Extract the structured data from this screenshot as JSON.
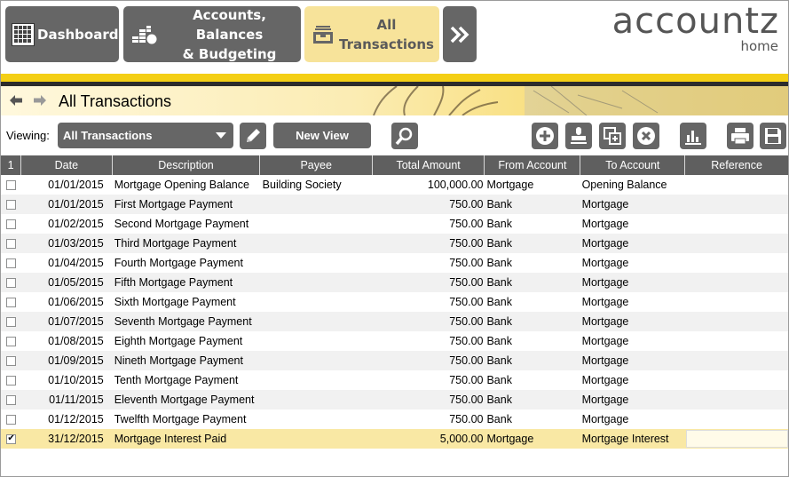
{
  "nav": {
    "dashboard": "Dashboard",
    "accounts_line1": "Accounts, Balances",
    "accounts_line2": "& Budgeting",
    "all_line1": "All",
    "all_line2": "Transactions",
    "more_icon": "double-chevron-right-icon"
  },
  "logo": {
    "brand": "accountz",
    "sub": "home"
  },
  "page": {
    "title": "All Transactions"
  },
  "toolbar": {
    "viewing_label": "Viewing:",
    "view_selected": "All Transactions",
    "new_view_label": "New View"
  },
  "table": {
    "columns": [
      "1",
      "Date",
      "Description",
      "Payee",
      "Total Amount",
      "From Account",
      "To Account",
      "Reference"
    ],
    "rows": [
      {
        "checked": "",
        "date": "01/01/2015",
        "description": "Mortgage Opening Balance",
        "payee": "Building Society",
        "amount": "100,000.00",
        "from": "Mortgage",
        "to": "Opening Balance",
        "reference": ""
      },
      {
        "checked": "",
        "date": "01/01/2015",
        "description": "First Mortgage Payment",
        "payee": "",
        "amount": "750.00",
        "from": "Bank",
        "to": "Mortgage",
        "reference": ""
      },
      {
        "checked": "",
        "date": "01/02/2015",
        "description": "Second Mortgage Payment",
        "payee": "",
        "amount": "750.00",
        "from": "Bank",
        "to": "Mortgage",
        "reference": ""
      },
      {
        "checked": "",
        "date": "01/03/2015",
        "description": "Third Mortgage Payment",
        "payee": "",
        "amount": "750.00",
        "from": "Bank",
        "to": "Mortgage",
        "reference": ""
      },
      {
        "checked": "",
        "date": "01/04/2015",
        "description": "Fourth Mortgage Payment",
        "payee": "",
        "amount": "750.00",
        "from": "Bank",
        "to": "Mortgage",
        "reference": ""
      },
      {
        "checked": "",
        "date": "01/05/2015",
        "description": "Fifth Mortgage Payment",
        "payee": "",
        "amount": "750.00",
        "from": "Bank",
        "to": "Mortgage",
        "reference": ""
      },
      {
        "checked": "",
        "date": "01/06/2015",
        "description": "Sixth Mortgage Payment",
        "payee": "",
        "amount": "750.00",
        "from": "Bank",
        "to": "Mortgage",
        "reference": ""
      },
      {
        "checked": "",
        "date": "01/07/2015",
        "description": "Seventh Mortgage Payment",
        "payee": "",
        "amount": "750.00",
        "from": "Bank",
        "to": "Mortgage",
        "reference": ""
      },
      {
        "checked": "",
        "date": "01/08/2015",
        "description": "Eighth Mortgage Payment",
        "payee": "",
        "amount": "750.00",
        "from": "Bank",
        "to": "Mortgage",
        "reference": ""
      },
      {
        "checked": "",
        "date": "01/09/2015",
        "description": "Nineth Mortgage Payment",
        "payee": "",
        "amount": "750.00",
        "from": "Bank",
        "to": "Mortgage",
        "reference": ""
      },
      {
        "checked": "",
        "date": "01/10/2015",
        "description": "Tenth Mortgage Payment",
        "payee": "",
        "amount": "750.00",
        "from": "Bank",
        "to": "Mortgage",
        "reference": ""
      },
      {
        "checked": "",
        "date": "01/11/2015",
        "description": "Eleventh Mortgage Payment",
        "payee": "",
        "amount": "750.00",
        "from": "Bank",
        "to": "Mortgage",
        "reference": ""
      },
      {
        "checked": "",
        "date": "01/12/2015",
        "description": "Twelfth Mortgage Payment",
        "payee": "",
        "amount": "750.00",
        "from": "Bank",
        "to": "Mortgage",
        "reference": ""
      },
      {
        "checked": "✔",
        "date": "31/12/2015",
        "description": "Mortgage Interest Paid",
        "payee": "",
        "amount": "5,000.00",
        "from": "Mortgage",
        "to": "Mortgage Interest",
        "reference": ""
      }
    ]
  },
  "colors": {
    "accent_yellow": "#f4cf15",
    "button_gray": "#666666",
    "selected_row": "#f9e8a4",
    "active_nav": "#f7e39a"
  }
}
